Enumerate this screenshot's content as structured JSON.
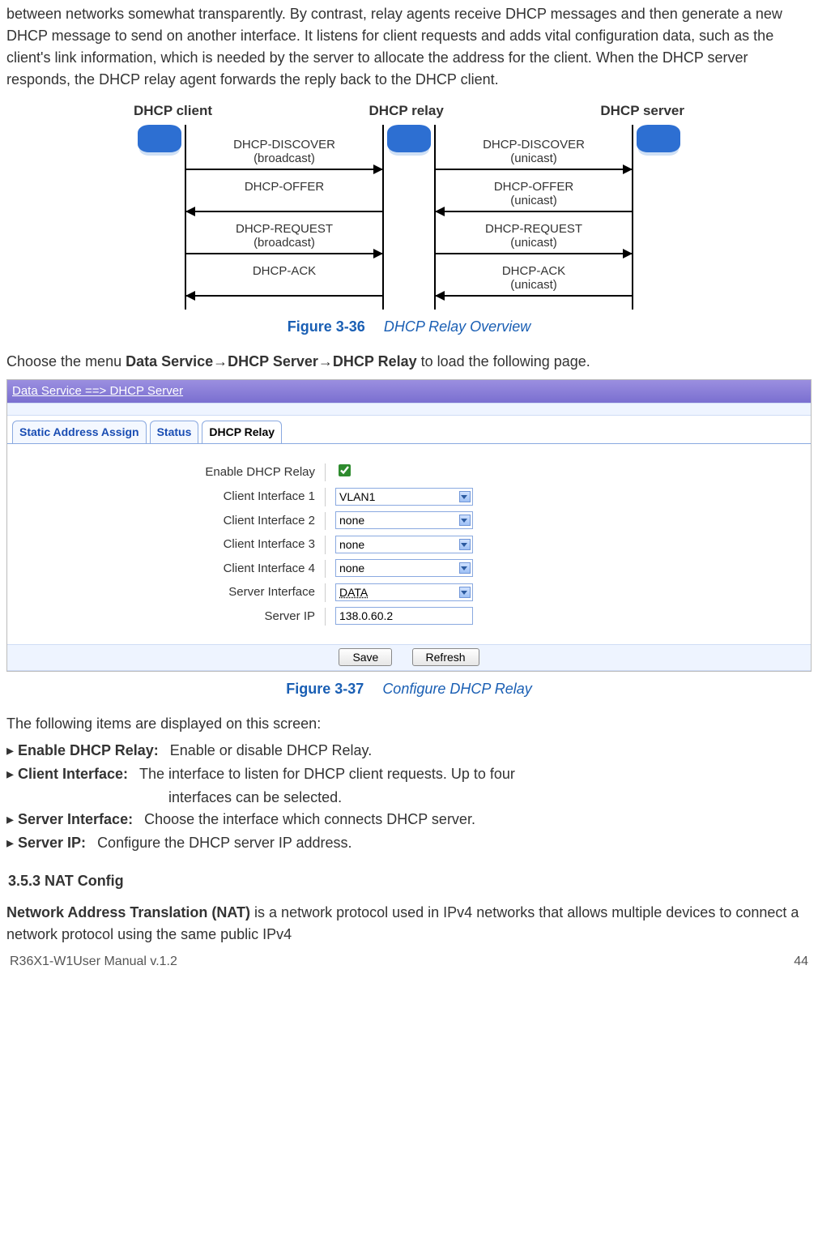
{
  "intro_paragraph": "between networks somewhat transparently. By contrast, relay agents receive DHCP messages and then generate a new DHCP message to send on another interface. It listens for client requests and adds vital configuration data, such as the client's link information, which is needed by the server to allocate the address for the client. When the DHCP server responds, the DHCP relay agent forwards the reply back to the DHCP client.",
  "diagram": {
    "header": {
      "client": "DHCP client",
      "relay": "DHCP relay",
      "server": "DHCP server"
    },
    "left_arrows": [
      {
        "label": "DHCP-DISCOVER\n(broadcast)",
        "dir": "right"
      },
      {
        "label": "DHCP-OFFER",
        "dir": "left"
      },
      {
        "label": "DHCP-REQUEST\n(broadcast)",
        "dir": "right"
      },
      {
        "label": "DHCP-ACK",
        "dir": "left"
      }
    ],
    "right_arrows": [
      {
        "label": "DHCP-DISCOVER\n(unicast)",
        "dir": "right"
      },
      {
        "label": "DHCP-OFFER\n(unicast)",
        "dir": "left"
      },
      {
        "label": "DHCP-REQUEST\n(unicast)",
        "dir": "right"
      },
      {
        "label": "DHCP-ACK\n(unicast)",
        "dir": "left"
      }
    ]
  },
  "figure36": {
    "num": "Figure 3-36",
    "title": "DHCP Relay Overview"
  },
  "menu_instruction": {
    "prefix": "Choose the menu ",
    "path1": "Data Service",
    "arrow": "→",
    "path2": "DHCP Server",
    "path3": "DHCP Relay",
    "suffix": " to load the following page."
  },
  "config": {
    "title": "Data Service ==> DHCP Server",
    "tabs": [
      "Static Address Assign",
      "Status",
      "DHCP Relay"
    ],
    "active_tab": 2,
    "fields": {
      "enable_label": "Enable DHCP Relay",
      "enable_checked": true,
      "ci1_label": "Client Interface 1",
      "ci1_value": "VLAN1",
      "ci2_label": "Client Interface 2",
      "ci2_value": "none",
      "ci3_label": "Client Interface 3",
      "ci3_value": "none",
      "ci4_label": "Client Interface 4",
      "ci4_value": "none",
      "si_label": "Server Interface",
      "si_value": "DATA",
      "sip_label": "Server IP",
      "sip_value": "138.0.60.2"
    },
    "buttons": {
      "save": "Save",
      "refresh": "Refresh"
    }
  },
  "figure37": {
    "num": "Figure 3-37",
    "title": "Configure DHCP Relay"
  },
  "items_intro": "The following items are displayed on this screen:",
  "definitions": [
    {
      "term": "Enable DHCP Relay:",
      "desc": "Enable or disable DHCP Relay."
    },
    {
      "term": "Client Interface:",
      "desc": "The interface to listen for DHCP client requests. Up to four",
      "cont": "interfaces can be selected."
    },
    {
      "term": "Server Interface:",
      "desc": "Choose the interface which connects DHCP server."
    },
    {
      "term": "Server IP:",
      "desc": "Configure the DHCP server IP address."
    }
  ],
  "section_353": "3.5.3 NAT Config",
  "nat_paragraph": {
    "bold": "Network Address Translation (NAT)",
    "rest": " is a network protocol used in IPv4 networks that allows multiple devices to connect a network protocol using the same public IPv4"
  },
  "footer": {
    "left": "R36X1-W1User Manual v.1.2",
    "right": "44"
  }
}
